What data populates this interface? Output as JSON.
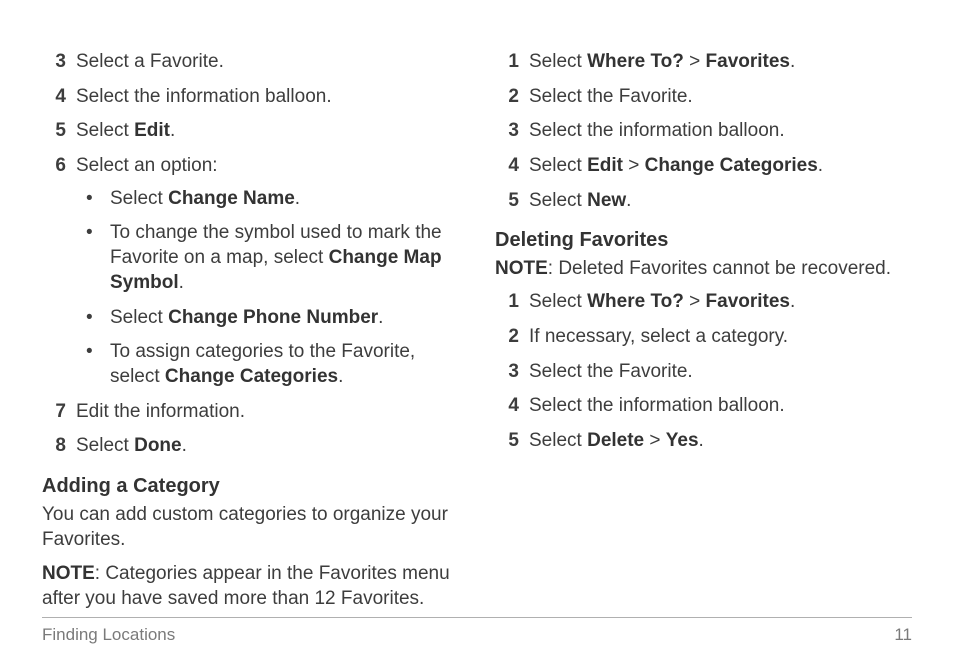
{
  "col1": {
    "steps": [
      {
        "n": "3",
        "pre": "Select a Favorite."
      },
      {
        "n": "4",
        "pre": "Select the information balloon."
      },
      {
        "n": "5",
        "pre": "Select ",
        "b": "Edit",
        "post": "."
      },
      {
        "n": "6",
        "pre": "Select an option:",
        "sub": [
          {
            "pre": "Select ",
            "b": "Change Name",
            "post": "."
          },
          {
            "pre": "To change the symbol used to mark the Favorite on a map, select ",
            "b": "Change Map Symbol",
            "post": "."
          },
          {
            "pre": "Select ",
            "b": "Change Phone Number",
            "post": "."
          },
          {
            "pre": "To assign categories to the Favorite, select ",
            "b": "Change Categories",
            "post": "."
          }
        ]
      },
      {
        "n": "7",
        "pre": "Edit the information."
      },
      {
        "n": "8",
        "pre": "Select ",
        "b": "Done",
        "post": "."
      }
    ],
    "heading": "Adding a Category",
    "body": "You can add custom categories to organize your Favorites.",
    "note_label": "NOTE",
    "note_body": ": Categories appear in the Favorites menu after you have saved more than 12 Favorites."
  },
  "col2": {
    "stepsA": [
      {
        "n": "1",
        "pre": "Select ",
        "b": "Where To?",
        "mid": " > ",
        "b2": "Favorites",
        "post": "."
      },
      {
        "n": "2",
        "pre": "Select the Favorite."
      },
      {
        "n": "3",
        "pre": "Select the information balloon."
      },
      {
        "n": "4",
        "pre": "Select ",
        "b": "Edit",
        "mid": " > ",
        "b2": "Change Categories",
        "post": "."
      },
      {
        "n": "5",
        "pre": "Select ",
        "b": "New",
        "post": "."
      }
    ],
    "heading": "Deleting Favorites",
    "note_label": "NOTE",
    "note_body": ": Deleted Favorites cannot be recovered.",
    "stepsB": [
      {
        "n": "1",
        "pre": "Select ",
        "b": "Where To?",
        "mid": " > ",
        "b2": "Favorites",
        "post": "."
      },
      {
        "n": "2",
        "pre": "If necessary, select a category."
      },
      {
        "n": "3",
        "pre": "Select the Favorite."
      },
      {
        "n": "4",
        "pre": "Select the information balloon."
      },
      {
        "n": "5",
        "pre": "Select ",
        "b": "Delete",
        "mid": " > ",
        "b2": "Yes",
        "post": "."
      }
    ]
  },
  "footer": {
    "left": "Finding Locations",
    "right": "11"
  }
}
